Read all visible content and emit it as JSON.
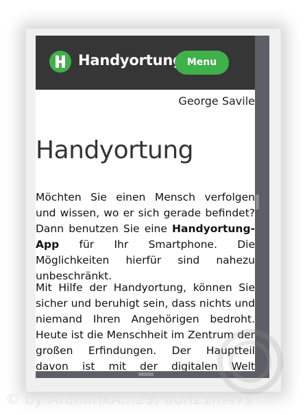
{
  "header": {
    "brand": "Handyortung",
    "menu_label": "Menu",
    "colors": {
      "bar": "#363636",
      "accent": "#3fb14a"
    },
    "logo_icon": "green-h-logo-icon"
  },
  "article": {
    "author": "George Savile",
    "title": "Handyortung",
    "para1_before": "Möchten Sie einen Mensch verfolgen und wissen, wo er sich gerade befindet? Dann benutzen Sie eine ",
    "para1_bold": "Handyortung-App",
    "para1_after": " für Ihr Smartphone. Die Möglichkeiten hierfür sind nahezu unbeschränkt.",
    "para2": "Mit Hilfe der Handyortung, können Sie sicher und beruhigt sein, dass nichts und niemand Ihren Angehörigen bedroht. Heute ist die Menschheit im Zentrum der großen Erfindungen. Der Hauptteil davon ist mit der digitalen Welt verbunden. Wir"
  },
  "watermark": {
    "text": "© by AranankA...29, 00h21m47s"
  }
}
